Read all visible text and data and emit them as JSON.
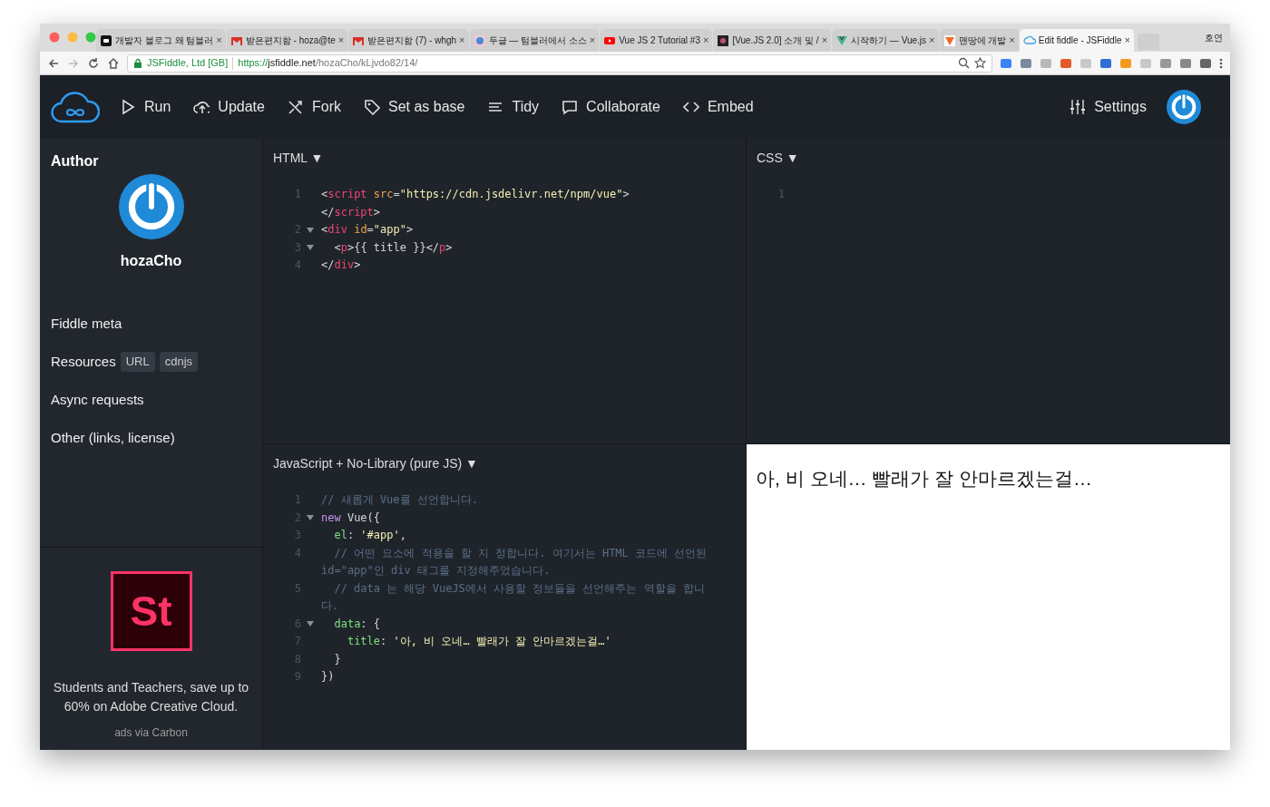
{
  "browser": {
    "tabs": [
      {
        "title": "개발자 블로그 왜 텀블러",
        "selected": false
      },
      {
        "title": "받은편지함 - hoza@te",
        "selected": false
      },
      {
        "title": "받은편지함 (7) - whgh",
        "selected": false
      },
      {
        "title": "두글 — 텀블러에서 소스",
        "selected": false
      },
      {
        "title": "Vue JS 2 Tutorial #3",
        "selected": false
      },
      {
        "title": "[Vue.JS 2.0] 소개 및 /",
        "selected": false
      },
      {
        "title": "시작하기 — Vue.js",
        "selected": false
      },
      {
        "title": "맨땅에 개발",
        "selected": false
      },
      {
        "title": "Edit fiddle - JSFiddle",
        "selected": true
      }
    ],
    "profile": "호연",
    "close_glyph": "×",
    "site_identity": "JSFiddle, Ltd [GB]",
    "url": {
      "scheme": "https://",
      "host": "jsfiddle.net",
      "path": "/hozaCho/kLjvdo82/14/"
    }
  },
  "toolbar": {
    "actions": [
      "Run",
      "Update",
      "Fork",
      "Set as base",
      "Tidy",
      "Collaborate",
      "Embed"
    ],
    "settings": "Settings"
  },
  "sidebar": {
    "author_heading": "Author",
    "author_name": "hozaCho",
    "sections": [
      {
        "label": "Fiddle meta"
      },
      {
        "label": "Resources",
        "badges": [
          "URL",
          "cdnjs"
        ]
      },
      {
        "label": "Async requests"
      },
      {
        "label": "Other (links, license)"
      }
    ],
    "ad": {
      "logo": "St",
      "text": "Students and Teachers, save up to 60% on Adobe Creative Cloud.",
      "via": "ads via Carbon"
    }
  },
  "panels": {
    "html": {
      "title": "HTML",
      "arrow": "▼",
      "lines": [
        {
          "number": "1",
          "fold": false,
          "rows": [
            [
              {
                "kind": "punct",
                "text": "<"
              },
              {
                "kind": "tag",
                "text": "script"
              },
              {
                "kind": "plain",
                "text": " "
              },
              {
                "kind": "attr",
                "text": "src"
              },
              {
                "kind": "punct",
                "text": "="
              },
              {
                "kind": "string",
                "text": "\"https://cdn.jsdelivr.net/npm/vue\""
              },
              {
                "kind": "punct",
                "text": ">"
              }
            ],
            [
              {
                "kind": "punct",
                "text": "</"
              },
              {
                "kind": "tag",
                "text": "script"
              },
              {
                "kind": "punct",
                "text": ">"
              }
            ]
          ]
        },
        {
          "number": "2",
          "fold": true,
          "rows": [
            [
              {
                "kind": "punct",
                "text": "<"
              },
              {
                "kind": "tag",
                "text": "div"
              },
              {
                "kind": "plain",
                "text": " "
              },
              {
                "kind": "attr",
                "text": "id"
              },
              {
                "kind": "punct",
                "text": "="
              },
              {
                "kind": "string",
                "text": "\"app\""
              },
              {
                "kind": "punct",
                "text": ">"
              }
            ]
          ]
        },
        {
          "number": "3",
          "fold": true,
          "rows": [
            [
              {
                "kind": "plain",
                "text": "  "
              },
              {
                "kind": "punct",
                "text": "<"
              },
              {
                "kind": "tag",
                "text": "p"
              },
              {
                "kind": "punct",
                "text": ">"
              },
              {
                "kind": "plain",
                "text": "{{ title }}"
              },
              {
                "kind": "punct",
                "text": "</"
              },
              {
                "kind": "tag",
                "text": "p"
              },
              {
                "kind": "punct",
                "text": ">"
              }
            ]
          ]
        },
        {
          "number": "4",
          "fold": false,
          "rows": [
            [
              {
                "kind": "punct",
                "text": "</"
              },
              {
                "kind": "tag",
                "text": "div"
              },
              {
                "kind": "punct",
                "text": ">"
              }
            ]
          ]
        }
      ]
    },
    "css": {
      "title": "CSS",
      "arrow": "▼",
      "lines": [
        {
          "number": "1",
          "fold": false,
          "rows": [
            []
          ]
        }
      ]
    },
    "js": {
      "title": "JavaScript + No-Library (pure JS)",
      "arrow": "▼",
      "lines": [
        {
          "number": "1",
          "fold": false,
          "rows": [
            [
              {
                "kind": "comment",
                "text": "// 새롭게 Vue를 선언합니다."
              }
            ]
          ]
        },
        {
          "number": "2",
          "fold": true,
          "rows": [
            [
              {
                "kind": "keyword",
                "text": "new"
              },
              {
                "kind": "plain",
                "text": " Vue({"
              }
            ]
          ]
        },
        {
          "number": "3",
          "fold": false,
          "rows": [
            [
              {
                "kind": "plain",
                "text": "  "
              },
              {
                "kind": "prop",
                "text": "el"
              },
              {
                "kind": "plain",
                "text": ": "
              },
              {
                "kind": "string",
                "text": "'#app'"
              },
              {
                "kind": "plain",
                "text": ","
              }
            ]
          ]
        },
        {
          "number": "4",
          "fold": false,
          "rows": [
            [
              {
                "kind": "comment",
                "text": "  // 어떤 요소에 적용을 할 지 정합니다. 여기서는 HTML 코드에 선언된"
              }
            ],
            [
              {
                "kind": "comment",
                "text": "id=\"app\"인 div 태그를 지정해주었습니다."
              }
            ]
          ]
        },
        {
          "number": "5",
          "fold": false,
          "rows": [
            [
              {
                "kind": "comment",
                "text": "  // data 는 해당 VueJS에서 사용할 정보들을 선언해주는 역할을 합니"
              }
            ],
            [
              {
                "kind": "comment",
                "text": "다."
              }
            ]
          ]
        },
        {
          "number": "6",
          "fold": true,
          "rows": [
            [
              {
                "kind": "plain",
                "text": "  "
              },
              {
                "kind": "prop",
                "text": "data"
              },
              {
                "kind": "plain",
                "text": ": {"
              }
            ]
          ]
        },
        {
          "number": "7",
          "fold": false,
          "rows": [
            [
              {
                "kind": "plain",
                "text": "    "
              },
              {
                "kind": "prop",
                "text": "title"
              },
              {
                "kind": "plain",
                "text": ": "
              },
              {
                "kind": "string",
                "text": "'아, 비 오네… 빨래가 잘 안마르겠는걸…'"
              }
            ]
          ]
        },
        {
          "number": "8",
          "fold": false,
          "rows": [
            [
              {
                "kind": "plain",
                "text": "  }"
              }
            ]
          ]
        },
        {
          "number": "9",
          "fold": false,
          "rows": [
            [
              {
                "kind": "plain",
                "text": "})"
              }
            ]
          ]
        }
      ]
    },
    "result": {
      "text": "아, 비 오네… 빨래가 잘 안마르겠는걸…"
    }
  }
}
